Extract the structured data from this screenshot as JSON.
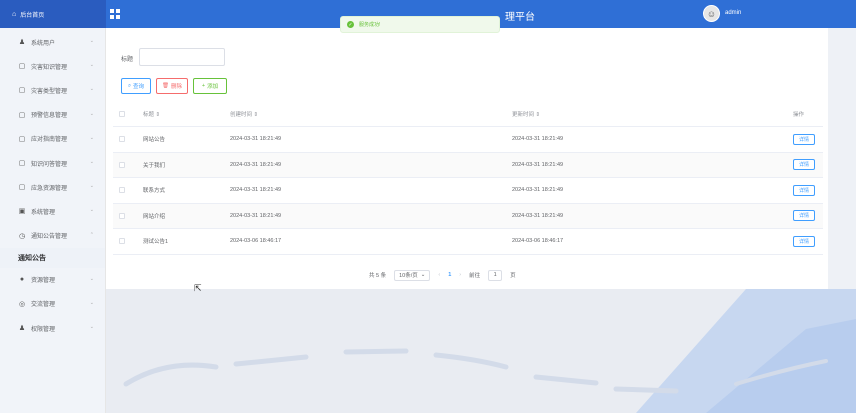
{
  "header": {
    "brand": "后台首页",
    "platform_title": "理平台",
    "user_name": "admin"
  },
  "toast": {
    "message": "服务成功!"
  },
  "sidebar": {
    "items": [
      {
        "icon": "user-icon",
        "label": "系统用户"
      },
      {
        "icon": "doc-icon",
        "label": "灾害知识管理"
      },
      {
        "icon": "doc-icon",
        "label": "灾害类型管理"
      },
      {
        "icon": "doc-icon",
        "label": "预警信息管理"
      },
      {
        "icon": "doc-icon",
        "label": "应对指南管理"
      },
      {
        "icon": "doc-icon",
        "label": "知识问答管理"
      },
      {
        "icon": "doc-icon",
        "label": "应急资源管理"
      },
      {
        "icon": "image-icon",
        "label": "系统管理"
      },
      {
        "icon": "clock-icon",
        "label": "通知公告管理"
      }
    ],
    "active_sub": "通知公告",
    "items_after": [
      {
        "icon": "pin-icon",
        "label": "资源管理"
      },
      {
        "icon": "circle-icon",
        "label": "交流管理"
      },
      {
        "icon": "user-icon",
        "label": "权限管理"
      }
    ]
  },
  "search": {
    "label": "标题",
    "value": ""
  },
  "buttons": {
    "query": "查询",
    "delete": "删除",
    "add": "添加"
  },
  "table": {
    "headers": [
      "标题 ⇕",
      "创建时间 ⇕",
      "更新时间 ⇕",
      "操作"
    ],
    "rows": [
      {
        "title": "网站公告",
        "created": "2024-03-31 18:21:49",
        "updated": "2024-03-31 18:21:49",
        "op": "详情"
      },
      {
        "title": "关于我们",
        "created": "2024-03-31 18:21:49",
        "updated": "2024-03-31 18:21:49",
        "op": "详情"
      },
      {
        "title": "联系方式",
        "created": "2024-03-31 18:21:49",
        "updated": "2024-03-31 18:21:49",
        "op": "详情"
      },
      {
        "title": "网站介绍",
        "created": "2024-03-31 18:21:49",
        "updated": "2024-03-31 18:21:49",
        "op": "详情"
      },
      {
        "title": "测试公告1",
        "created": "2024-03-06 18:46:17",
        "updated": "2024-03-06 18:46:17",
        "op": "详情"
      }
    ]
  },
  "pager": {
    "total": "共 5 条",
    "page_size": "10条/页",
    "current": "1",
    "goto_label": "前往",
    "goto_value": "1",
    "page_unit": "页"
  },
  "colors": {
    "header": "#2f6fd6",
    "brand_bg": "#2a5cbf",
    "primary": "#409eff",
    "danger": "#f56c6c",
    "success": "#67c23a"
  }
}
